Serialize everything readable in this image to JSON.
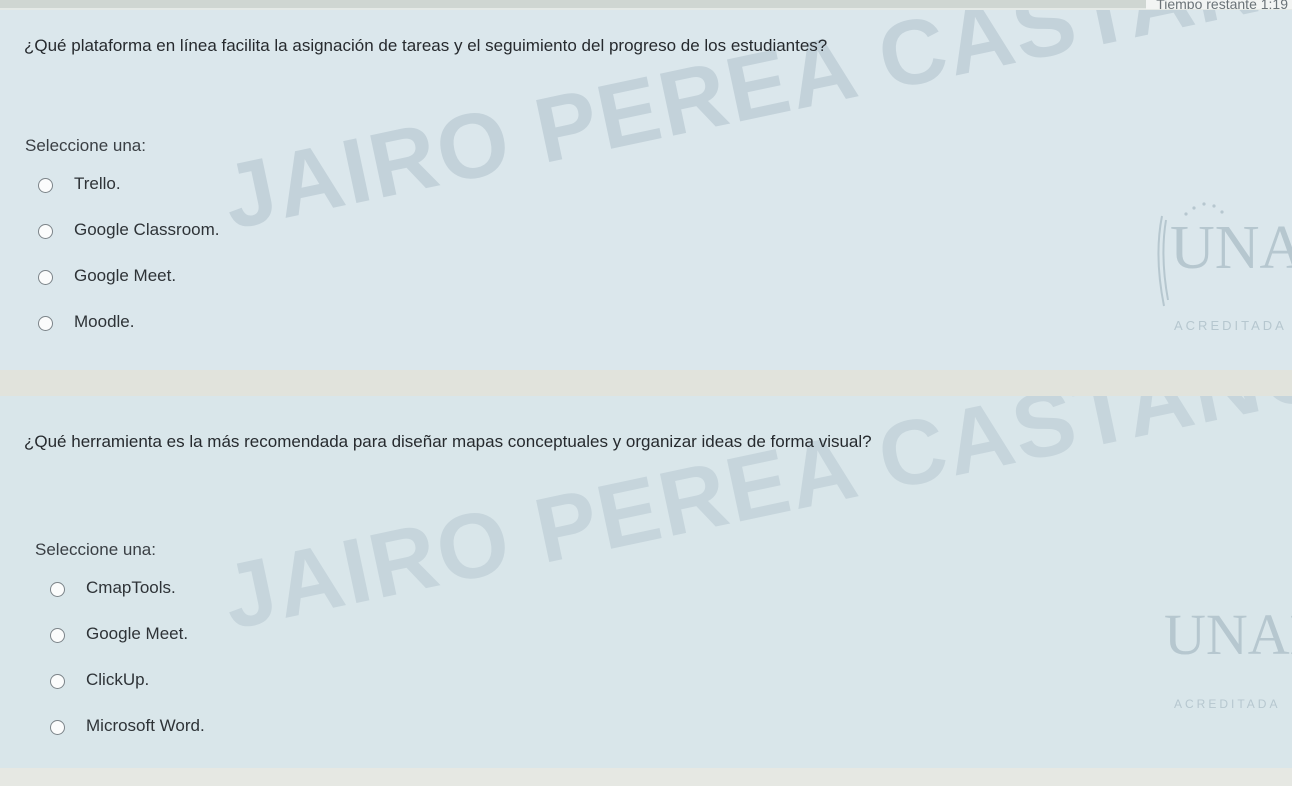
{
  "timer": {
    "text": "Tiempo restante 1:19"
  },
  "watermark": {
    "text": "JAIRO PEREA CASTANO"
  },
  "logo": {
    "text": "UNAD",
    "accreditation": "ACREDITADA"
  },
  "questions": [
    {
      "text": "¿Qué plataforma en línea facilita la asignación de tareas y el seguimiento del progreso de los estudiantes?",
      "prompt": "Seleccione una:",
      "options": [
        "Trello.",
        "Google Classroom.",
        "Google Meet.",
        "Moodle."
      ]
    },
    {
      "text": "¿Qué herramienta es la más recomendada para diseñar mapas conceptuales y organizar ideas de forma visual?",
      "prompt": "Seleccione una:",
      "options": [
        "CmapTools.",
        "Google Meet.",
        "ClickUp.",
        "Microsoft Word."
      ]
    }
  ],
  "colors": {
    "panel": "#dbe7ec",
    "gap": "#e1e3dc",
    "watermark": "#c3d2da",
    "text": "#262a2e"
  }
}
